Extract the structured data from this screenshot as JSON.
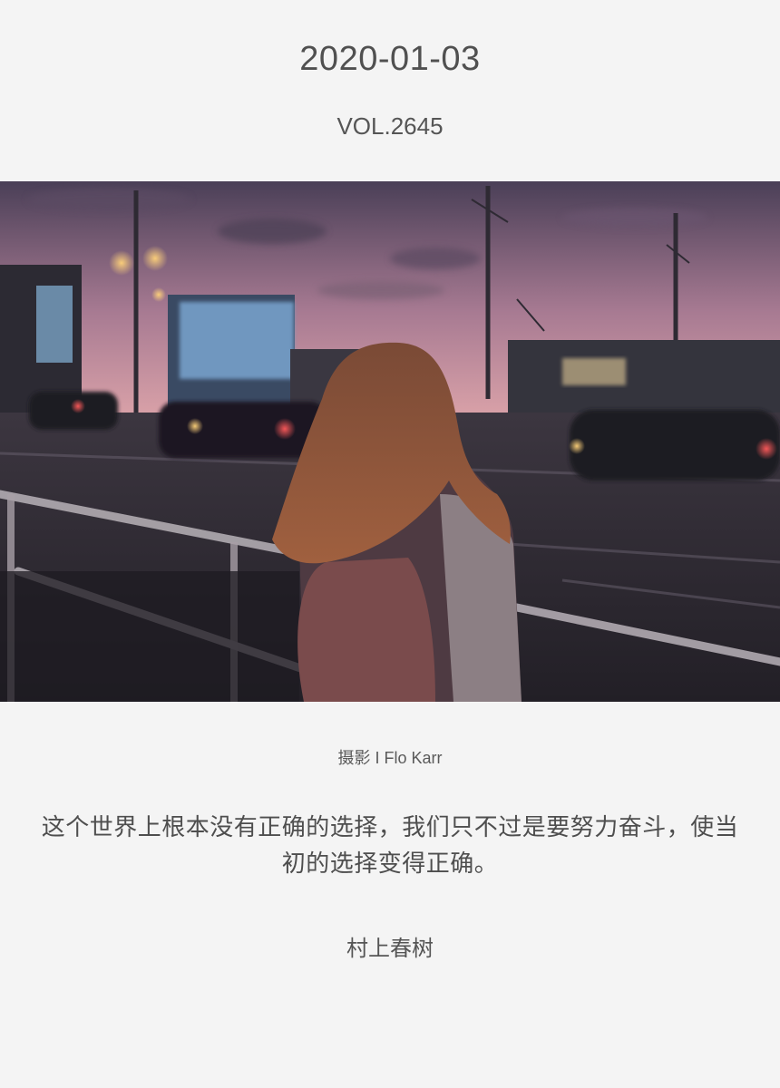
{
  "header": {
    "date": "2020-01-03",
    "volume": "VOL.2645"
  },
  "photo": {
    "credit": "摄影 I Flo Karr"
  },
  "quote": {
    "text": "这个世界上根本没有正确的选择，我们只不过是要努力奋斗，使当初的选择变得正确。",
    "author": "村上春树"
  }
}
